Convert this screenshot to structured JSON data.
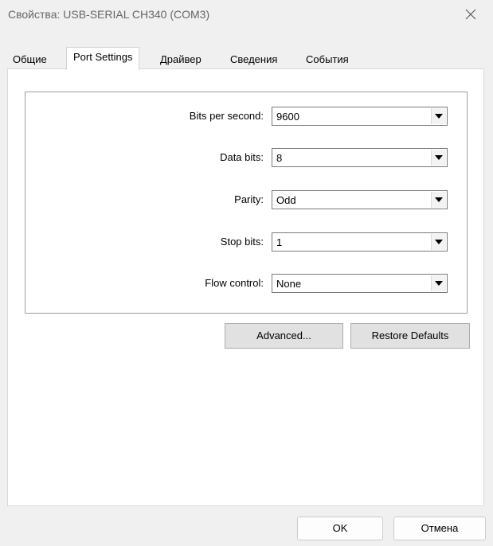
{
  "window": {
    "title": "Свойства: USB-SERIAL CH340 (COM3)",
    "close_icon": "close-icon"
  },
  "tabs": [
    {
      "label": "Общие",
      "active": false
    },
    {
      "label": "Port Settings",
      "active": true
    },
    {
      "label": "Драйвер",
      "active": false
    },
    {
      "label": "Сведения",
      "active": false
    },
    {
      "label": "События",
      "active": false
    }
  ],
  "port_settings": {
    "bits_per_second": {
      "label": "Bits per second:",
      "value": "9600"
    },
    "data_bits": {
      "label": "Data bits:",
      "value": "8"
    },
    "parity": {
      "label": "Parity:",
      "value": "Odd"
    },
    "stop_bits": {
      "label": "Stop bits:",
      "value": "1"
    },
    "flow_control": {
      "label": "Flow control:",
      "value": "None"
    }
  },
  "buttons": {
    "advanced": "Advanced...",
    "restore_defaults": "Restore Defaults",
    "ok": "OK",
    "cancel": "Отмена"
  }
}
